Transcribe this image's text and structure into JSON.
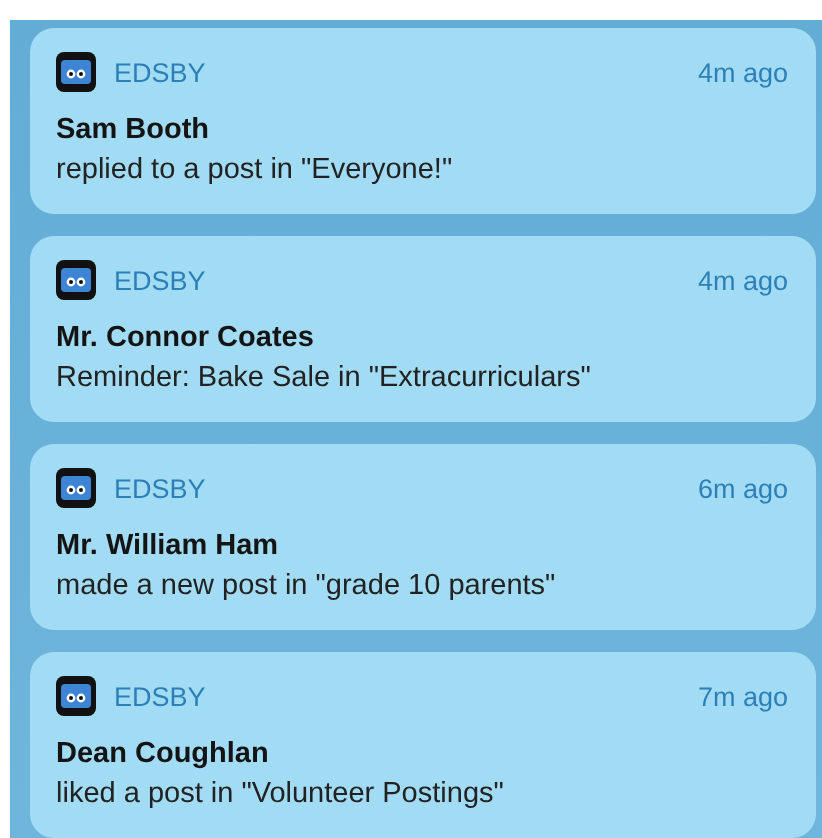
{
  "notifications": [
    {
      "app": "EDSBY",
      "time": "4m ago",
      "title": "Sam Booth",
      "message": "replied to a post in \"Everyone!\""
    },
    {
      "app": "EDSBY",
      "time": "4m ago",
      "title": "Mr. Connor Coates",
      "message": "Reminder: Bake Sale in \"Extracurriculars\""
    },
    {
      "app": "EDSBY",
      "time": "6m ago",
      "title": "Mr. William Ham",
      "message": "made a new post in \"grade 10 parents\""
    },
    {
      "app": "EDSBY",
      "time": "7m ago",
      "title": "Dean Coughlan",
      "message": "liked a post in \"Volunteer Postings\""
    }
  ]
}
